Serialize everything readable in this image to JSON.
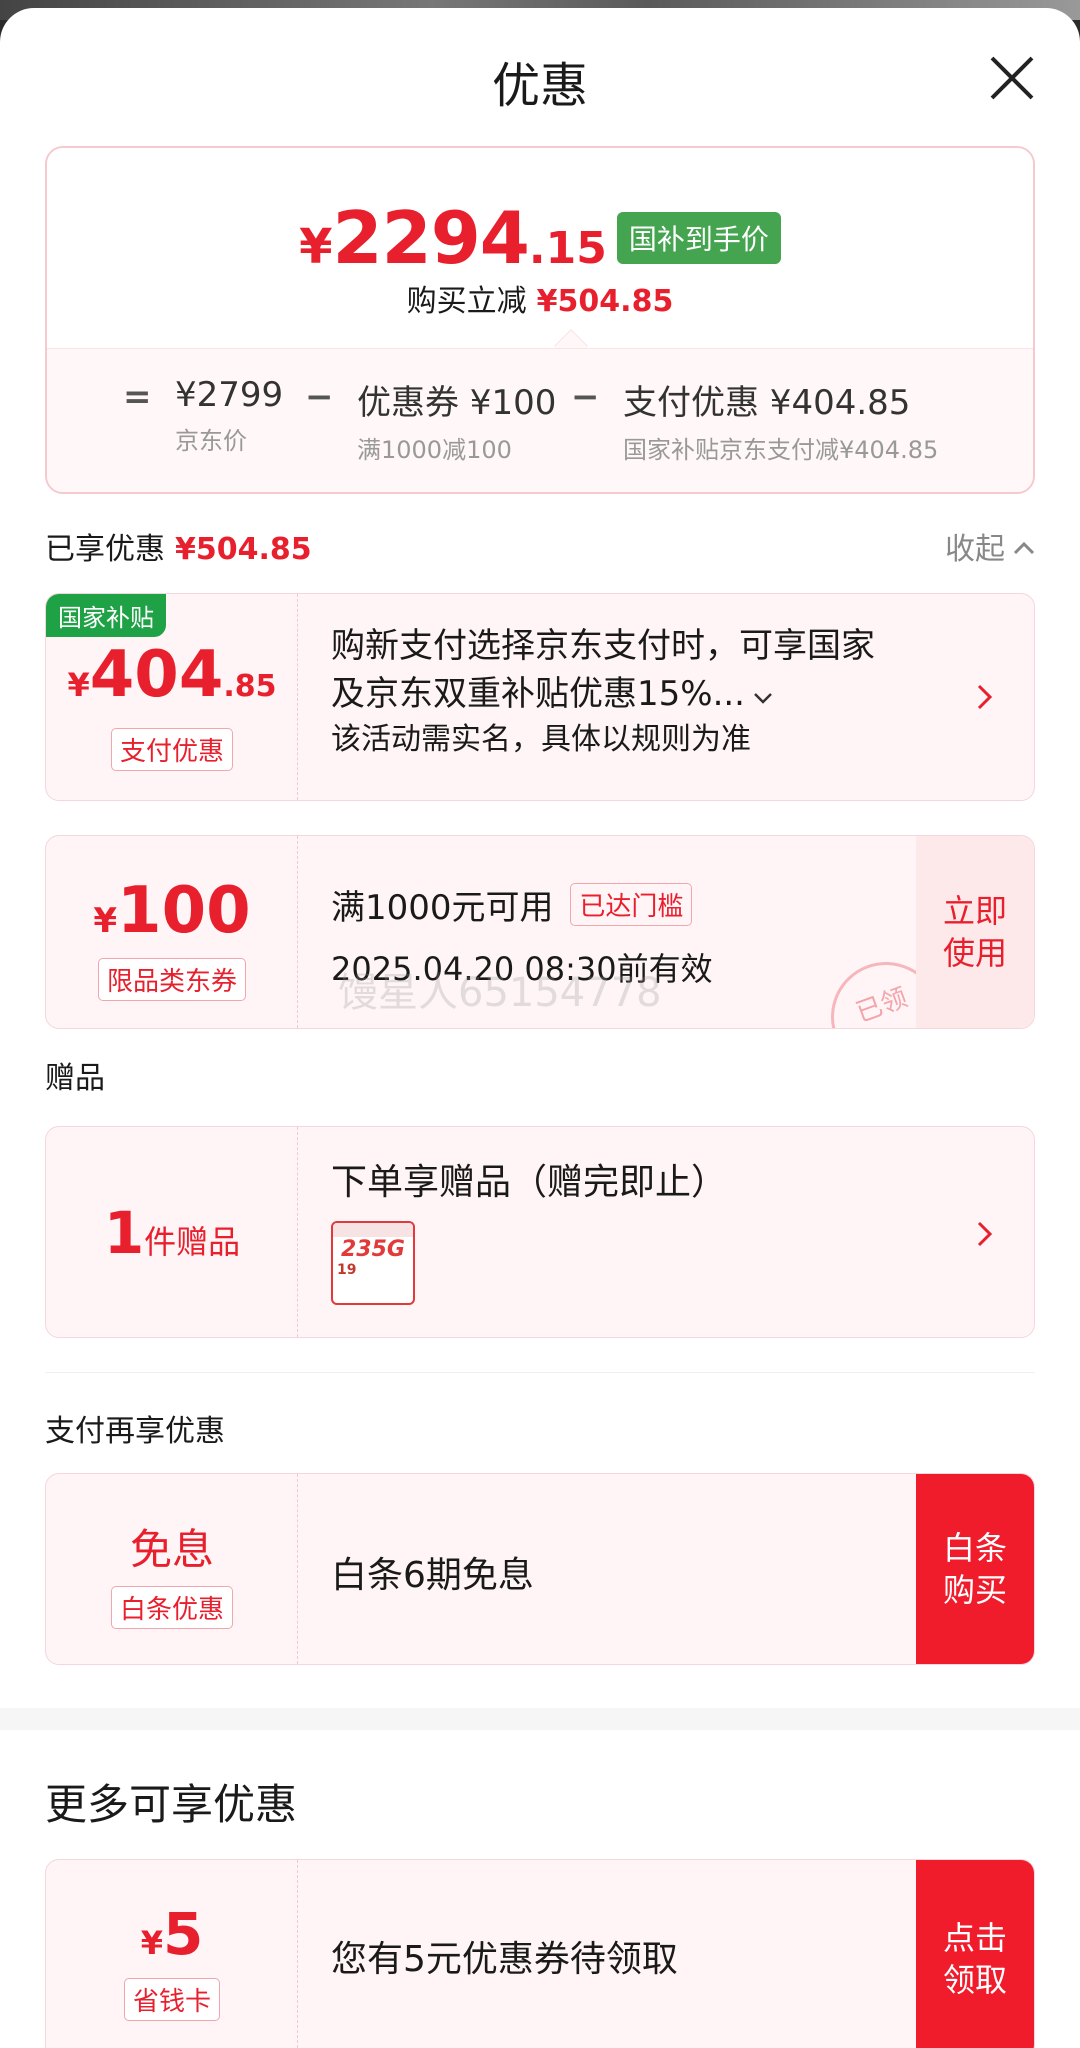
{
  "header": {
    "title": "优惠"
  },
  "summary": {
    "currency": "¥",
    "price_int": "2294",
    "price_dec": ".15",
    "price_tag": "国补到手价",
    "reduce_label": "购买立减",
    "reduce_amount": "¥504.85",
    "formula": {
      "eq": "=",
      "minus": "−",
      "jd_price": "¥2799",
      "jd_price_label": "京东价",
      "coupon": "优惠券 ¥100",
      "coupon_label": "满1000减100",
      "payment": "支付优惠 ¥404.85",
      "payment_label": "国家补贴京东支付减¥404.85"
    }
  },
  "enjoyed": {
    "label": "已享优惠",
    "amount": "¥504.85",
    "collapse": "收起"
  },
  "subsidy_card": {
    "corner_tag": "国家补贴",
    "currency": "¥",
    "amount_int": "404",
    "amount_dec": ".85",
    "badge": "支付优惠",
    "line1": "购新支付选择京东支付时，可享国家",
    "line2": "及京东双重补贴优惠15%...",
    "note": "该活动需实名，具体以规则为准"
  },
  "coupon_card": {
    "currency": "¥",
    "amount": "100",
    "badge": "限品类东券",
    "condition": "满1000元可用",
    "reached": "已达门槛",
    "validity": "2025.04.20 08:30前有效",
    "watermark": "馒星人65154778",
    "stamp": "已领",
    "action": "立即\n使用"
  },
  "gift_section": {
    "title": "赠品"
  },
  "gift_card": {
    "count": "1",
    "unit": "件赠品",
    "desc": "下单享赠品（赠完即止）",
    "thumb_text": "235G",
    "thumb_price": "19"
  },
  "pay_section": {
    "title": "支付再享优惠"
  },
  "baitiao_card": {
    "main": "免息",
    "badge": "白条优惠",
    "desc": "白条6期免息",
    "action": "白条\n购买"
  },
  "more_section": {
    "title": "更多可享优惠"
  },
  "saver_card": {
    "currency": "¥",
    "amount": "5",
    "badge": "省钱卡",
    "desc": "您有5元优惠券待领取",
    "action": "点击\n领取"
  },
  "colors": {
    "accent": "#e8202e",
    "green": "#44a450",
    "tag_green": "#1fa245"
  }
}
